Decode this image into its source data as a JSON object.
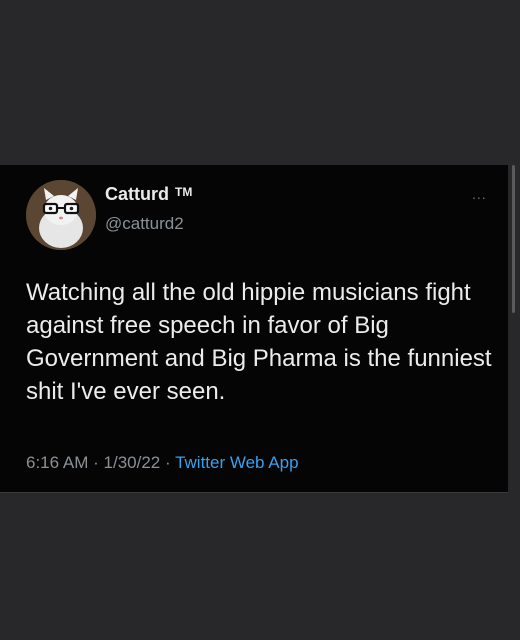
{
  "tweet": {
    "display_name": "Catturd",
    "trademark": "TM",
    "handle": "@catturd2",
    "more_icon": "...",
    "text": "Watching all the old hippie musicians fight against free speech in favor of Big Government and Big Pharma is the funniest shit I've ever seen.",
    "time": "6:16 AM",
    "separator": "·",
    "date": "1/30/22",
    "source": "Twitter Web App"
  },
  "colors": {
    "background": "#28282a",
    "card": "#050505",
    "text": "#ececec",
    "secondary": "#8b9096",
    "link": "#3aa0ee"
  },
  "icons": {
    "avatar": "cat-with-glasses-avatar",
    "more": "more-options-icon"
  }
}
